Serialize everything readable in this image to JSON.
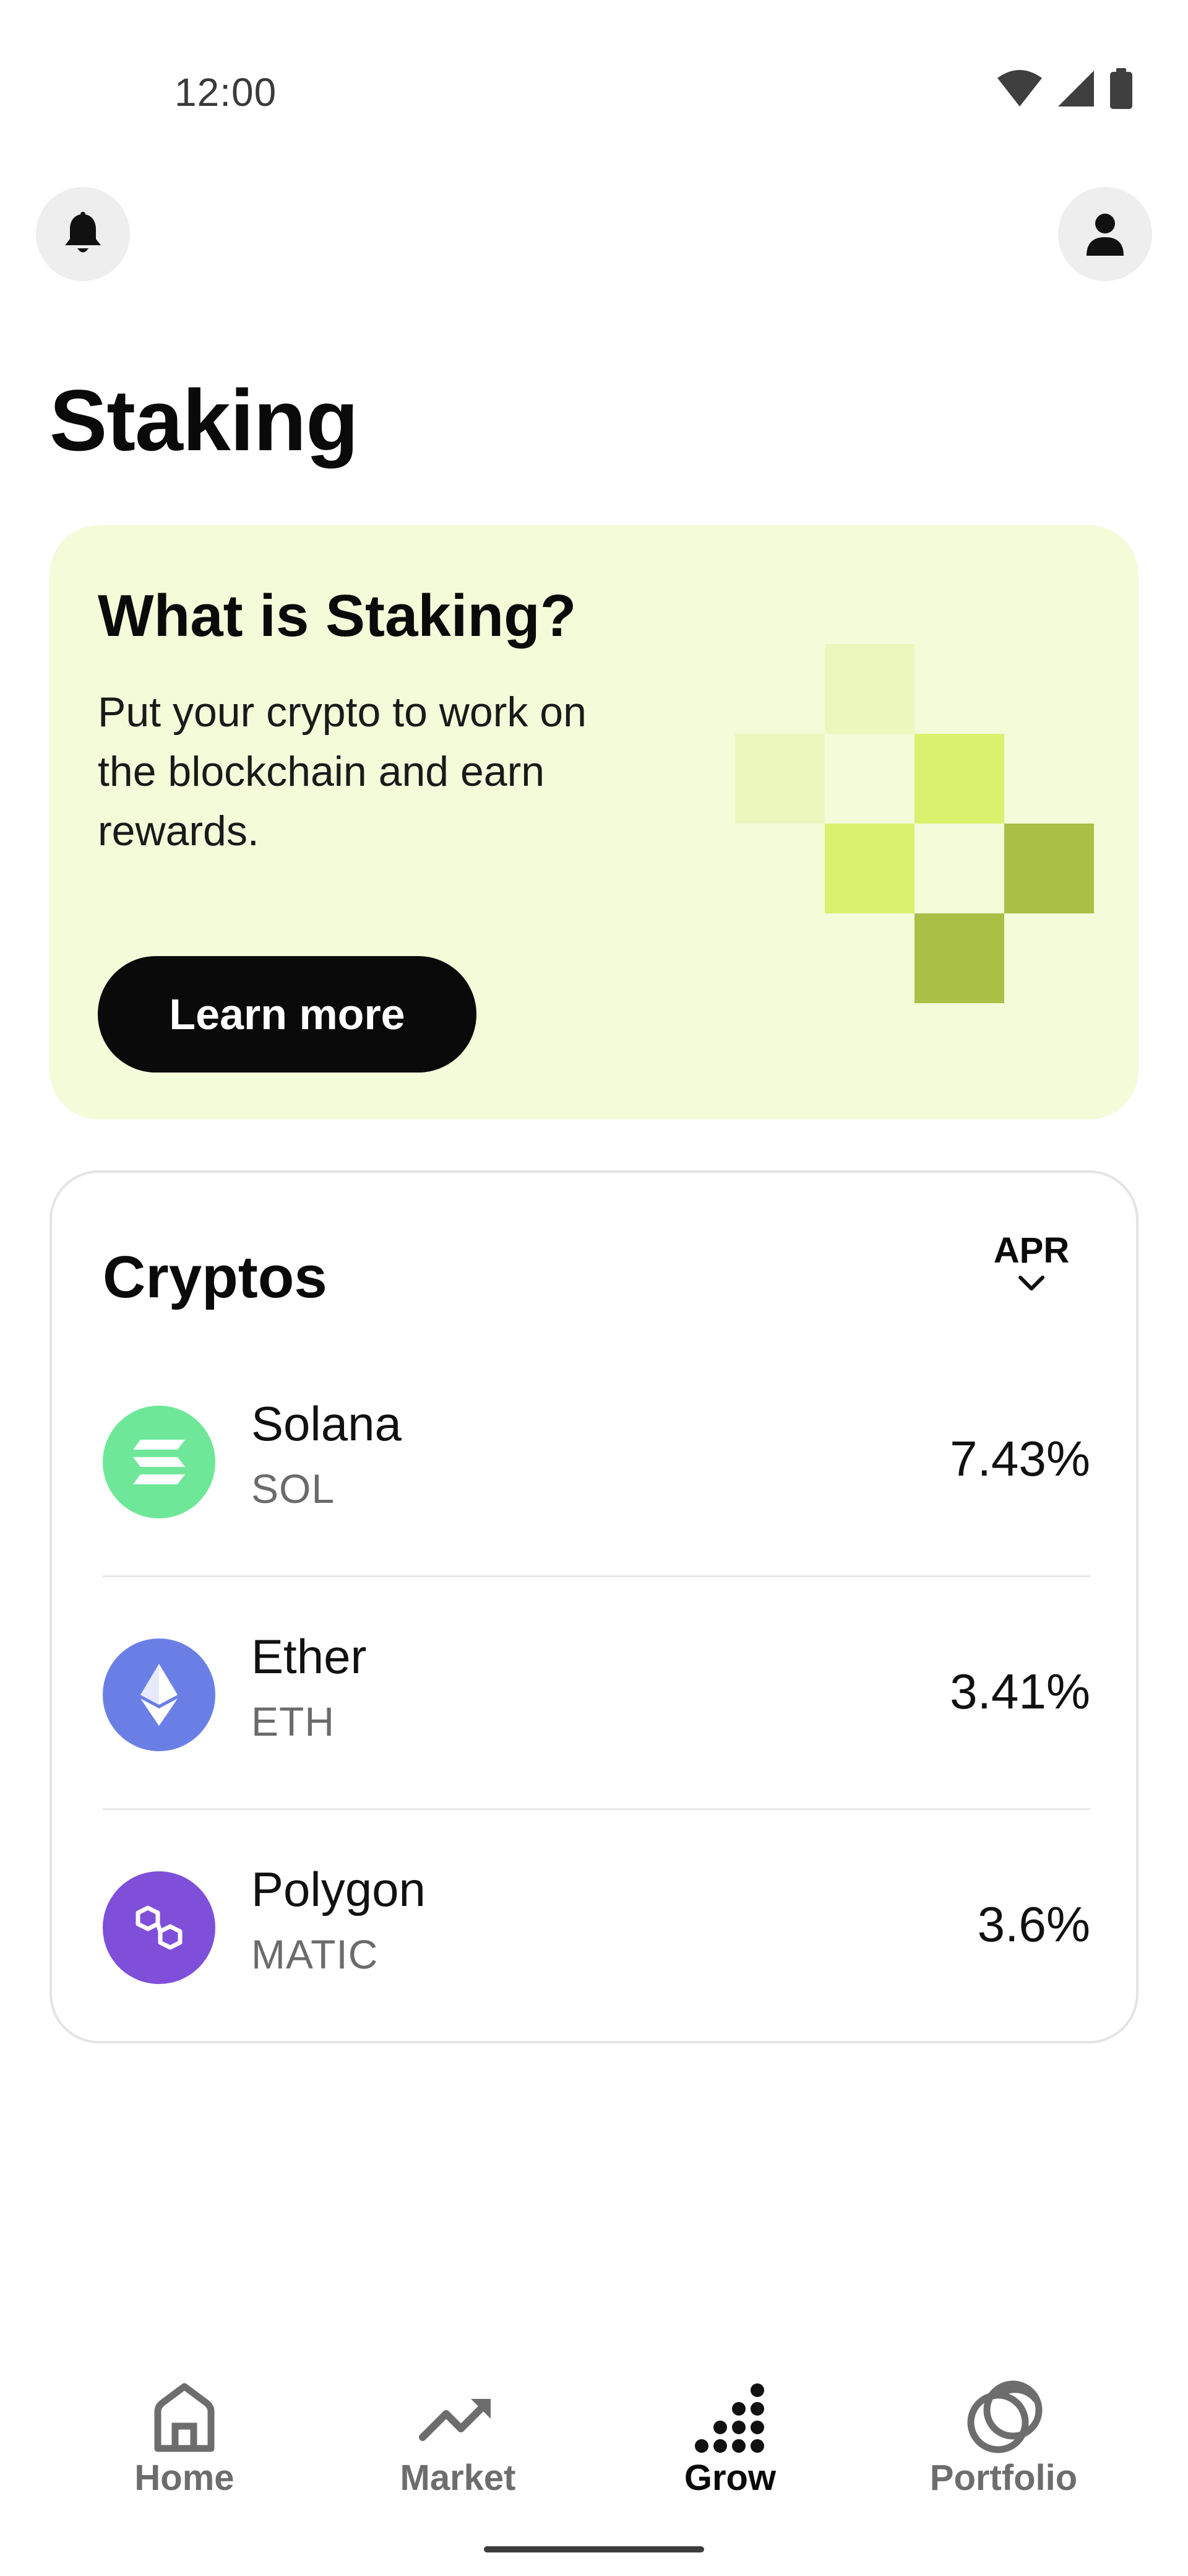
{
  "status_bar": {
    "time": "12:00"
  },
  "header": {
    "notifications_icon": "bell-icon",
    "profile_icon": "person-icon",
    "title": "Staking"
  },
  "promo": {
    "title": "What is Staking?",
    "body": "Put your crypto to work on the blockchain and earn rewards.",
    "button_label": "Learn more",
    "colors": {
      "background": "#f3fbd9",
      "pixel_light": "#ecf7bd",
      "pixel_mid": "#daf16e",
      "pixel_dark": "#a8c046"
    }
  },
  "cryptos": {
    "heading": "Cryptos",
    "sort_label": "APR",
    "items": [
      {
        "name": "Solana",
        "ticker": "SOL",
        "apr": "7.43%",
        "icon": "solana-icon",
        "color": "#6ee898"
      },
      {
        "name": "Ether",
        "ticker": "ETH",
        "apr": "3.41%",
        "icon": "ethereum-icon",
        "color": "#6a7fe6"
      },
      {
        "name": "Polygon",
        "ticker": "MATIC",
        "apr": "3.6%",
        "icon": "polygon-icon",
        "color": "#7f4fd9"
      }
    ]
  },
  "bottom_nav": {
    "items": [
      {
        "label": "Home",
        "icon": "home-icon",
        "active": false
      },
      {
        "label": "Market",
        "icon": "trend-up-icon",
        "active": false
      },
      {
        "label": "Grow",
        "icon": "grow-dots-icon",
        "active": true
      },
      {
        "label": "Portfolio",
        "icon": "portfolio-circles-icon",
        "active": false
      }
    ]
  }
}
